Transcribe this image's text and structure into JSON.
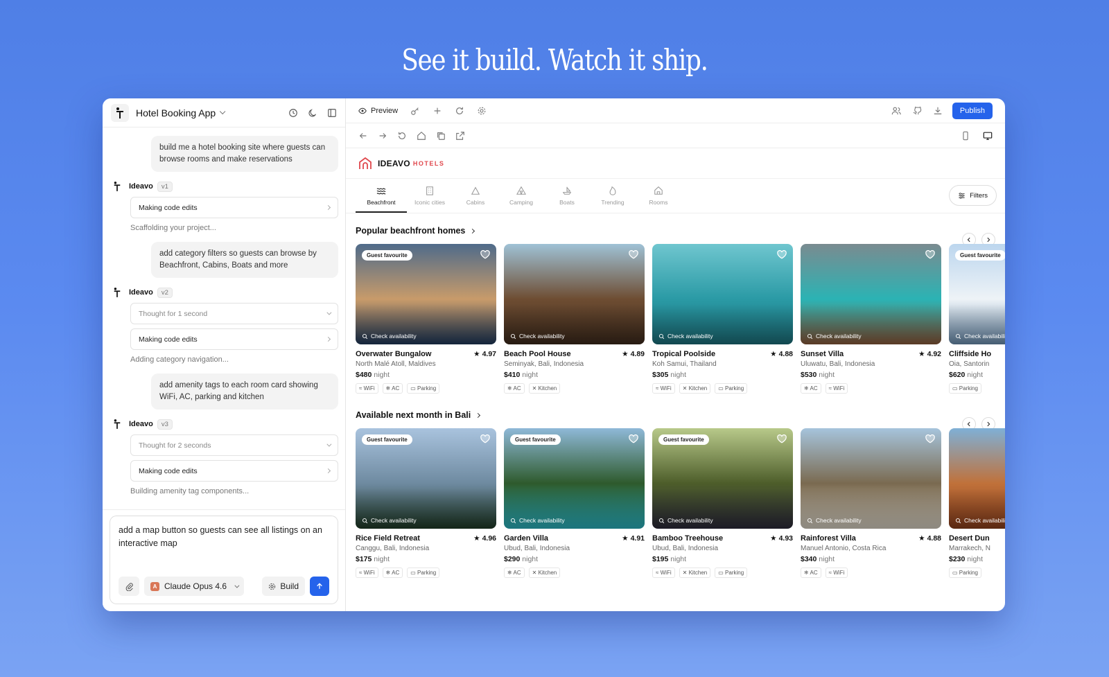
{
  "headline": "See it build. Watch it ship.",
  "app": {
    "title": "Hotel Booking App"
  },
  "chat": {
    "messages": [
      {
        "user": "build me a hotel booking site where guests can browse rooms and make reservations",
        "agent": "Ideavo",
        "version": "v1",
        "steps": [
          {
            "label": "Making code edits",
            "kind": "edit"
          }
        ],
        "status": "Scaffolding your project..."
      },
      {
        "user": "add category filters so guests can browse by Beachfront, Cabins, Boats and more",
        "agent": "Ideavo",
        "version": "v2",
        "steps": [
          {
            "label": "Thought for 1 second",
            "kind": "thought"
          },
          {
            "label": "Making code edits",
            "kind": "edit"
          }
        ],
        "status": "Adding category navigation..."
      },
      {
        "user": "add amenity tags to each room card showing WiFi, AC, parking and kitchen",
        "agent": "Ideavo",
        "version": "v3",
        "steps": [
          {
            "label": "Thought for 2 seconds",
            "kind": "thought"
          },
          {
            "label": "Making code edits",
            "kind": "edit"
          }
        ],
        "status": "Building amenity tag components..."
      }
    ],
    "composer": {
      "text": "add a map button so guests can see all listings on an interactive map",
      "model": "Claude Opus 4.6",
      "build_label": "Build"
    }
  },
  "toolbar": {
    "preview_label": "Preview",
    "publish_label": "Publish"
  },
  "site": {
    "brand": "IDEAVO",
    "brand_sub": "HOTELS",
    "categories": [
      "Beachfront",
      "Iconic cities",
      "Cabins",
      "Camping",
      "Boats",
      "Trending",
      "Rooms"
    ],
    "active_category": "Beachfront",
    "filters_label": "Filters",
    "badge_label": "Guest favourite",
    "check_label": "Check availability",
    "night_label": "night",
    "sections": [
      {
        "title": "Popular beachfront homes",
        "listings": [
          {
            "name": "Overwater Bungalow",
            "rating": "4.97",
            "location": "North Malé Atoll, Maldives",
            "price": "$480",
            "tags": [
              "WiFi",
              "AC",
              "Parking"
            ],
            "badge": true,
            "colors": [
              "#4f6b8a",
              "#c89b6a",
              "#1f3a5c"
            ]
          },
          {
            "name": "Beach Pool House",
            "rating": "4.89",
            "location": "Seminyak, Bali, Indonesia",
            "price": "$410",
            "tags": [
              "AC",
              "Kitchen"
            ],
            "badge": false,
            "colors": [
              "#9fc2d6",
              "#6e4d32",
              "#3d2a1c"
            ]
          },
          {
            "name": "Tropical Poolside",
            "rating": "4.88",
            "location": "Koh Samui, Thailand",
            "price": "$305",
            "tags": [
              "WiFi",
              "Kitchen",
              "Parking"
            ],
            "badge": false,
            "colors": [
              "#6fc6cf",
              "#2a9aa5",
              "#1c6f7a"
            ]
          },
          {
            "name": "Sunset Villa",
            "rating": "4.92",
            "location": "Uluwatu, Bali, Indonesia",
            "price": "$530",
            "tags": [
              "AC",
              "WiFi"
            ],
            "badge": false,
            "colors": [
              "#7a8b90",
              "#2bb3b4",
              "#8b5a3a"
            ]
          },
          {
            "name": "Cliffside Ho",
            "rating": "",
            "location": "Oia, Santorin",
            "price": "$620",
            "tags": [
              "Parking"
            ],
            "badge": true,
            "colors": [
              "#bcd6ee",
              "#eef3f7",
              "#6c8fb0"
            ]
          }
        ]
      },
      {
        "title": "Available next month in Bali",
        "listings": [
          {
            "name": "Rice Field Retreat",
            "rating": "4.96",
            "location": "Canggu, Bali, Indonesia",
            "price": "$175",
            "tags": [
              "WiFi",
              "AC",
              "Parking"
            ],
            "badge": true,
            "colors": [
              "#a9c3de",
              "#6e8aa0",
              "#1f3a26"
            ]
          },
          {
            "name": "Garden Villa",
            "rating": "4.91",
            "location": "Ubud, Bali, Indonesia",
            "price": "$290",
            "tags": [
              "AC",
              "Kitchen"
            ],
            "badge": true,
            "colors": [
              "#8fb9d8",
              "#2e5a2c",
              "#2bb3c0"
            ]
          },
          {
            "name": "Bamboo Treehouse",
            "rating": "4.93",
            "location": "Ubud, Bali, Indonesia",
            "price": "$195",
            "tags": [
              "WiFi",
              "Kitchen",
              "Parking"
            ],
            "badge": true,
            "colors": [
              "#b8c98a",
              "#4d5d2a",
              "#2c2a3a"
            ]
          },
          {
            "name": "Rainforest Villa",
            "rating": "4.88",
            "location": "Manuel Antonio, Costa Rica",
            "price": "$340",
            "tags": [
              "AC",
              "WiFi"
            ],
            "badge": false,
            "colors": [
              "#a6c4dc",
              "#7a6a50",
              "#d9d2c4"
            ]
          },
          {
            "name": "Desert Dun",
            "rating": "",
            "location": "Marrakech, N",
            "price": "$230",
            "tags": [
              "Parking"
            ],
            "badge": false,
            "colors": [
              "#7fb0d6",
              "#c0713a",
              "#8a3e1c"
            ]
          }
        ]
      }
    ]
  }
}
